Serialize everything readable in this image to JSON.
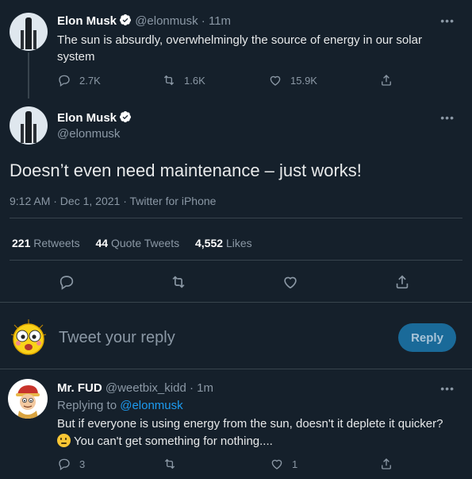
{
  "parent_tweet": {
    "name": "Elon Musk",
    "handle": "@elonmusk",
    "time": "· 11m",
    "text": "The sun is absurdly, overwhelmingly the source of energy in our solar system",
    "replies": "2.7K",
    "retweets": "1.6K",
    "likes": "15.9K"
  },
  "main_tweet": {
    "name": "Elon Musk",
    "handle": "@elonmusk",
    "text": "Doesn’t even need maintenance – just works!",
    "meta": "9:12 AM · Dec 1, 2021 · Twitter for iPhone",
    "retweets_count": "221",
    "retweets_label": "Retweets",
    "quotes_count": "44",
    "quotes_label": "Quote Tweets",
    "likes_count": "4,552",
    "likes_label": "Likes"
  },
  "reply_box": {
    "placeholder": "Tweet your reply",
    "button": "Reply"
  },
  "reply_tweet": {
    "name": "Mr. FUD",
    "handle": "@weetbix_kidd",
    "time": "· 1m",
    "replying_prefix": "Replying to",
    "replying_to": "@elonmusk",
    "text_line1": "But if everyone is using energy from the sun, doesn't it deplete it quicker?",
    "text_line2": "You can't get something for nothing....",
    "replies": "3",
    "likes": "1"
  },
  "more_label": "•••",
  "colors": {
    "background": "#15202b",
    "divider": "#38444d",
    "muted": "#8b98a5",
    "link": "#1d9bf0",
    "reply_button_bg": "#1a6a99",
    "verified": "#ffffff"
  },
  "icons": [
    "verified-badge-icon",
    "more-icon",
    "reply-icon",
    "retweet-icon",
    "like-icon",
    "share-icon",
    "thinking-emoji-icon"
  ]
}
